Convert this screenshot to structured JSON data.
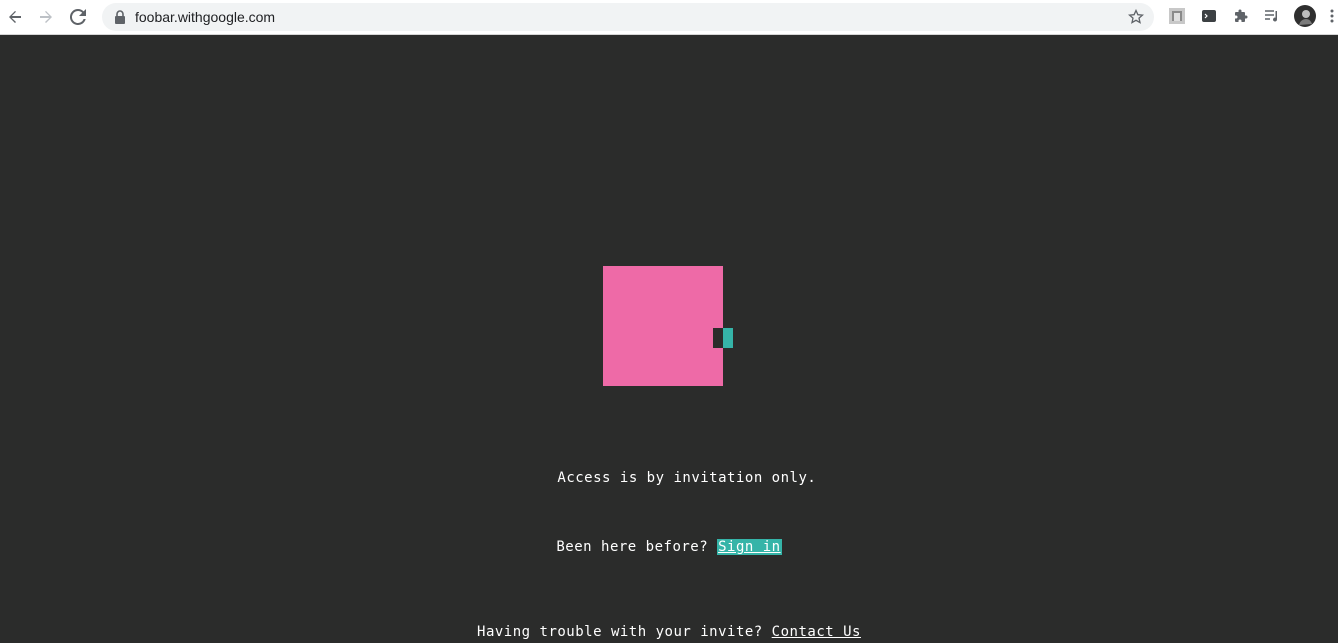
{
  "browser": {
    "url": "foobar.withgoogle.com"
  },
  "content": {
    "access_text": "Access is by invitation only.",
    "been_here_text": "Been here before? ",
    "sign_in_label": "Sign in",
    "trouble_text": "Having trouble with your invite? ",
    "contact_label": "Contact Us"
  },
  "colors": {
    "background": "#2b2c2b",
    "logo_pink": "#ee6aa7",
    "accent_teal": "#35b4a8"
  },
  "icons": [
    "back-icon",
    "forward-icon",
    "reload-icon",
    "lock-icon",
    "star-icon",
    "extension-photo-icon",
    "terminal-icon",
    "puzzle-icon",
    "media-queue-icon",
    "profile-avatar",
    "menu-icon"
  ]
}
